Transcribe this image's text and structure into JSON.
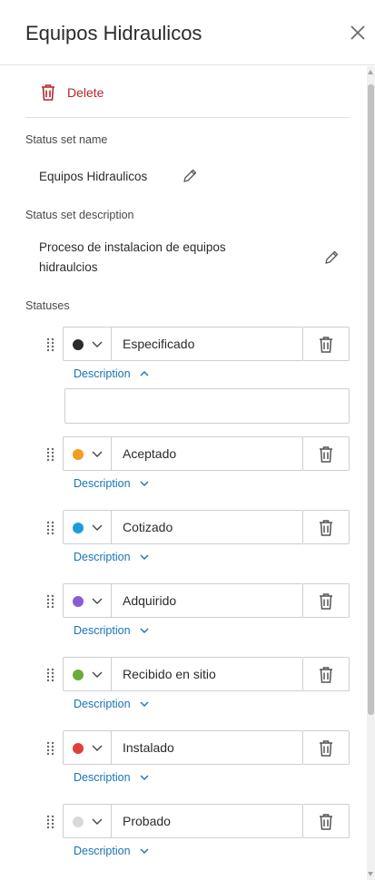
{
  "panel": {
    "title": "Equipos Hidraulicos"
  },
  "actions": {
    "delete_label": "Delete"
  },
  "status_set": {
    "name_label": "Status set name",
    "name_value": "Equipos Hidraulicos",
    "description_label": "Status set description",
    "description_value_line1": "Proceso de instalacion de equipos",
    "description_value_line2": "hidraulcios"
  },
  "statuses_label": "Statuses",
  "description_toggle_label": "Description",
  "statuses": [
    {
      "name": "Especificado",
      "color": "#2b2b2b",
      "description_expanded": true,
      "description_value": ""
    },
    {
      "name": "Aceptado",
      "color": "#f39c1f",
      "description_expanded": false
    },
    {
      "name": "Cotizado",
      "color": "#1e9bd7",
      "description_expanded": false
    },
    {
      "name": "Adquirido",
      "color": "#8a5bd6",
      "description_expanded": false
    },
    {
      "name": "Recibido en sitio",
      "color": "#6aab3a",
      "description_expanded": false
    },
    {
      "name": "Instalado",
      "color": "#e0403a",
      "description_expanded": false
    },
    {
      "name": "Probado",
      "color": "#d9d9d9",
      "description_expanded": false
    }
  ],
  "colors": {
    "delete_red": "#b5262b",
    "link_blue": "#1a73b5"
  },
  "icons": {
    "close": "close-icon",
    "delete": "trash-icon",
    "edit": "pencil-icon",
    "drag": "drag-handle-icon",
    "dropdown": "chevron-down-icon",
    "collapse": "chevron-up-icon"
  }
}
